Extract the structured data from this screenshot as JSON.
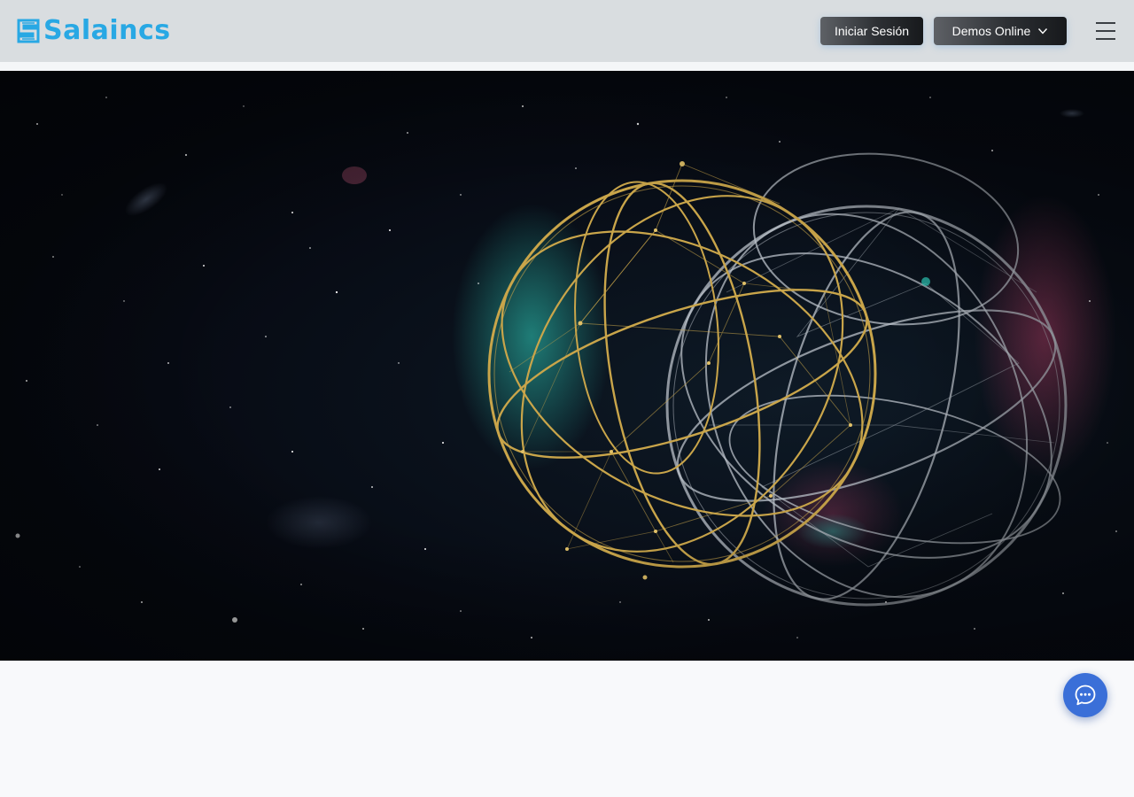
{
  "header": {
    "logo_text": "Salaincs",
    "logo_icon": "salaincs-logo-mark",
    "login_label": "Iniciar Sesión",
    "demos_label": "Demos Online",
    "demos_icon": "chevron-down-icon",
    "menu_icon": "hamburger-menu-icon"
  },
  "hero": {
    "image": "interlinked-wireframe-spheres-in-space",
    "colors": {
      "gold_sphere": "#c9a54a",
      "silver_sphere": "#b9c0c8",
      "teal_glow": "#2fd3c0",
      "pink_glow": "#d84a7a"
    }
  },
  "chat": {
    "icon": "chat-bubble-icon"
  },
  "colors": {
    "header_bg": "#d9dde0",
    "logo_blue": "#28a8e4",
    "button_dark": "#1f2226",
    "chat_blue": "#3a6fd8",
    "page_bg": "#f8f9fb"
  }
}
